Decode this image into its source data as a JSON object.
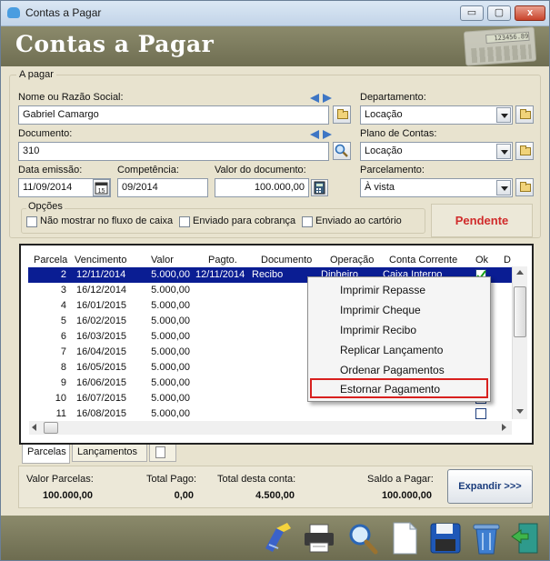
{
  "window": {
    "title": "Contas a Pagar",
    "banner_title": "Contas a Pagar",
    "calc_display": "123456.89",
    "controls": {
      "minimize": "▭",
      "maximize": "▢",
      "close": "x"
    }
  },
  "form": {
    "section_title": "A pagar",
    "nome_label": "Nome ou Razão Social:",
    "nome_value": "Gabriel Camargo",
    "documento_label": "Documento:",
    "documento_value": "310",
    "data_emissao_label": "Data emissão:",
    "data_emissao_value": "11/09/2014",
    "competencia_label": "Competência:",
    "competencia_value": "09/2014",
    "valor_doc_label": "Valor do documento:",
    "valor_doc_value": "100.000,00",
    "departamento_label": "Departamento:",
    "departamento_value": "Locação",
    "plano_label": "Plano de Contas:",
    "plano_value": "Locação",
    "parcelamento_label": "Parcelamento:",
    "parcelamento_value": "À vista",
    "opcoes_label": "Opções",
    "options": [
      {
        "label": "Não mostrar no fluxo de caixa",
        "checked": false
      },
      {
        "label": "Enviado para cobrança",
        "checked": false
      },
      {
        "label": "Enviado ao cartório",
        "checked": false
      }
    ],
    "status": "Pendente",
    "status_color": "#d02b2b"
  },
  "grid": {
    "headers": [
      "Parcela",
      "Vencimento",
      "Valor",
      "Pagto.",
      "Documento",
      "Operação",
      "Conta Corrente",
      "Ok",
      "D"
    ],
    "rows": [
      {
        "parcela": "2",
        "vencimento": "12/11/2014",
        "valor": "5.000,00",
        "pagto": "12/11/2014",
        "documento": "Recibo",
        "operacao": "Dinheiro",
        "conta": "Caixa Interno",
        "ok": true,
        "selected": true
      },
      {
        "parcela": "3",
        "vencimento": "16/12/2014",
        "valor": "5.000,00",
        "pagto": "",
        "documento": "",
        "operacao": "",
        "conta": "",
        "ok": false,
        "selected": false
      },
      {
        "parcela": "4",
        "vencimento": "16/01/2015",
        "valor": "5.000,00",
        "pagto": "",
        "documento": "",
        "operacao": "",
        "conta": "",
        "ok": false,
        "selected": false
      },
      {
        "parcela": "5",
        "vencimento": "16/02/2015",
        "valor": "5.000,00",
        "pagto": "",
        "documento": "",
        "operacao": "",
        "conta": "",
        "ok": false,
        "selected": false
      },
      {
        "parcela": "6",
        "vencimento": "16/03/2015",
        "valor": "5.000,00",
        "pagto": "",
        "documento": "",
        "operacao": "",
        "conta": "",
        "ok": false,
        "selected": false
      },
      {
        "parcela": "7",
        "vencimento": "16/04/2015",
        "valor": "5.000,00",
        "pagto": "",
        "documento": "",
        "operacao": "",
        "conta": "",
        "ok": false,
        "selected": false
      },
      {
        "parcela": "8",
        "vencimento": "16/05/2015",
        "valor": "5.000,00",
        "pagto": "",
        "documento": "",
        "operacao": "",
        "conta": "",
        "ok": false,
        "selected": false
      },
      {
        "parcela": "9",
        "vencimento": "16/06/2015",
        "valor": "5.000,00",
        "pagto": "",
        "documento": "",
        "operacao": "",
        "conta": "",
        "ok": false,
        "selected": false
      },
      {
        "parcela": "10",
        "vencimento": "16/07/2015",
        "valor": "5.000,00",
        "pagto": "",
        "documento": "",
        "operacao": "",
        "conta": "",
        "ok": false,
        "selected": false
      },
      {
        "parcela": "11",
        "vencimento": "16/08/2015",
        "valor": "5.000,00",
        "pagto": "",
        "documento": "",
        "operacao": "",
        "conta": "",
        "ok": false,
        "selected": false
      }
    ],
    "selection_color": "#0a1d93"
  },
  "context_menu": {
    "items": [
      "Imprimir Repasse",
      "Imprimir Cheque",
      "Imprimir Recibo",
      "Replicar Lançamento",
      "Ordenar Pagamentos",
      "Estornar Pagamento"
    ],
    "highlighted": "Estornar Pagamento",
    "highlight_color": "#d8201e"
  },
  "tabs": [
    "Parcelas",
    "Lançamentos"
  ],
  "totals": {
    "valor_parcelas_label": "Valor Parcelas:",
    "valor_parcelas_value": "100.000,00",
    "total_pago_label": "Total Pago:",
    "total_pago_value": "0,00",
    "total_conta_label": "Total desta conta:",
    "total_conta_value": "4.500,00",
    "saldo_label": "Saldo a Pagar:",
    "saldo_value": "100.000,00"
  },
  "expandir_label": "Expandir >>>",
  "toolbar_icons": [
    "clean-icon",
    "printer-icon",
    "search-icon",
    "new-document-icon",
    "save-icon",
    "delete-icon",
    "exit-icon"
  ]
}
